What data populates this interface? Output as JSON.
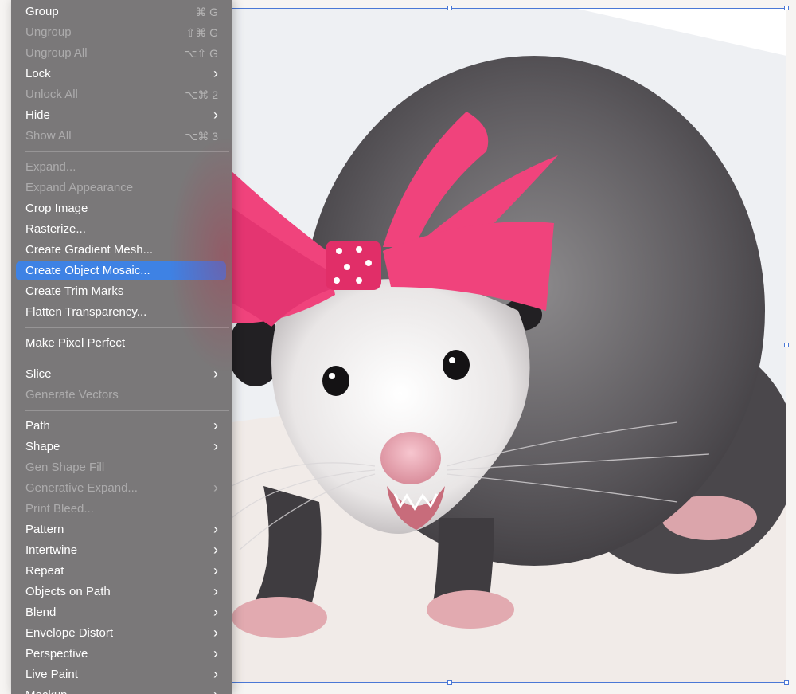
{
  "menu": {
    "group": {
      "label": "Group",
      "shortcut": "⌘ G"
    },
    "ungroup": {
      "label": "Ungroup",
      "shortcut": "⇧⌘ G"
    },
    "ungroup_all": {
      "label": "Ungroup All",
      "shortcut": "⌥⇧ G"
    },
    "lock": {
      "label": "Lock"
    },
    "unlock_all": {
      "label": "Unlock All",
      "shortcut": "⌥⌘ 2"
    },
    "hide": {
      "label": "Hide"
    },
    "show_all": {
      "label": "Show All",
      "shortcut": "⌥⌘ 3"
    },
    "expand": {
      "label": "Expand..."
    },
    "expand_appearance": {
      "label": "Expand Appearance"
    },
    "crop_image": {
      "label": "Crop Image"
    },
    "rasterize": {
      "label": "Rasterize..."
    },
    "create_gradient_mesh": {
      "label": "Create Gradient Mesh..."
    },
    "create_object_mosaic": {
      "label": "Create Object Mosaic..."
    },
    "create_trim_marks": {
      "label": "Create Trim Marks"
    },
    "flatten_transparency": {
      "label": "Flatten Transparency..."
    },
    "make_pixel_perfect": {
      "label": "Make Pixel Perfect"
    },
    "slice": {
      "label": "Slice"
    },
    "generate_vectors": {
      "label": "Generate Vectors"
    },
    "path": {
      "label": "Path"
    },
    "shape": {
      "label": "Shape"
    },
    "gen_shape_fill": {
      "label": "Gen Shape Fill"
    },
    "generative_expand": {
      "label": "Generative Expand..."
    },
    "print_bleed": {
      "label": "Print Bleed..."
    },
    "pattern": {
      "label": "Pattern"
    },
    "intertwine": {
      "label": "Intertwine"
    },
    "repeat": {
      "label": "Repeat"
    },
    "objects_on_path": {
      "label": "Objects on Path"
    },
    "blend": {
      "label": "Blend"
    },
    "envelope_distort": {
      "label": "Envelope Distort"
    },
    "perspective": {
      "label": "Perspective"
    },
    "live_paint": {
      "label": "Live Paint"
    },
    "mockup": {
      "label": "Mockup"
    },
    "submenu_glyph": "›"
  },
  "colors": {
    "menu_bg": "#6f6d70",
    "highlight": "#3e82e4",
    "selection_frame": "#4a78d6",
    "bow_pink": "#f0437c"
  }
}
